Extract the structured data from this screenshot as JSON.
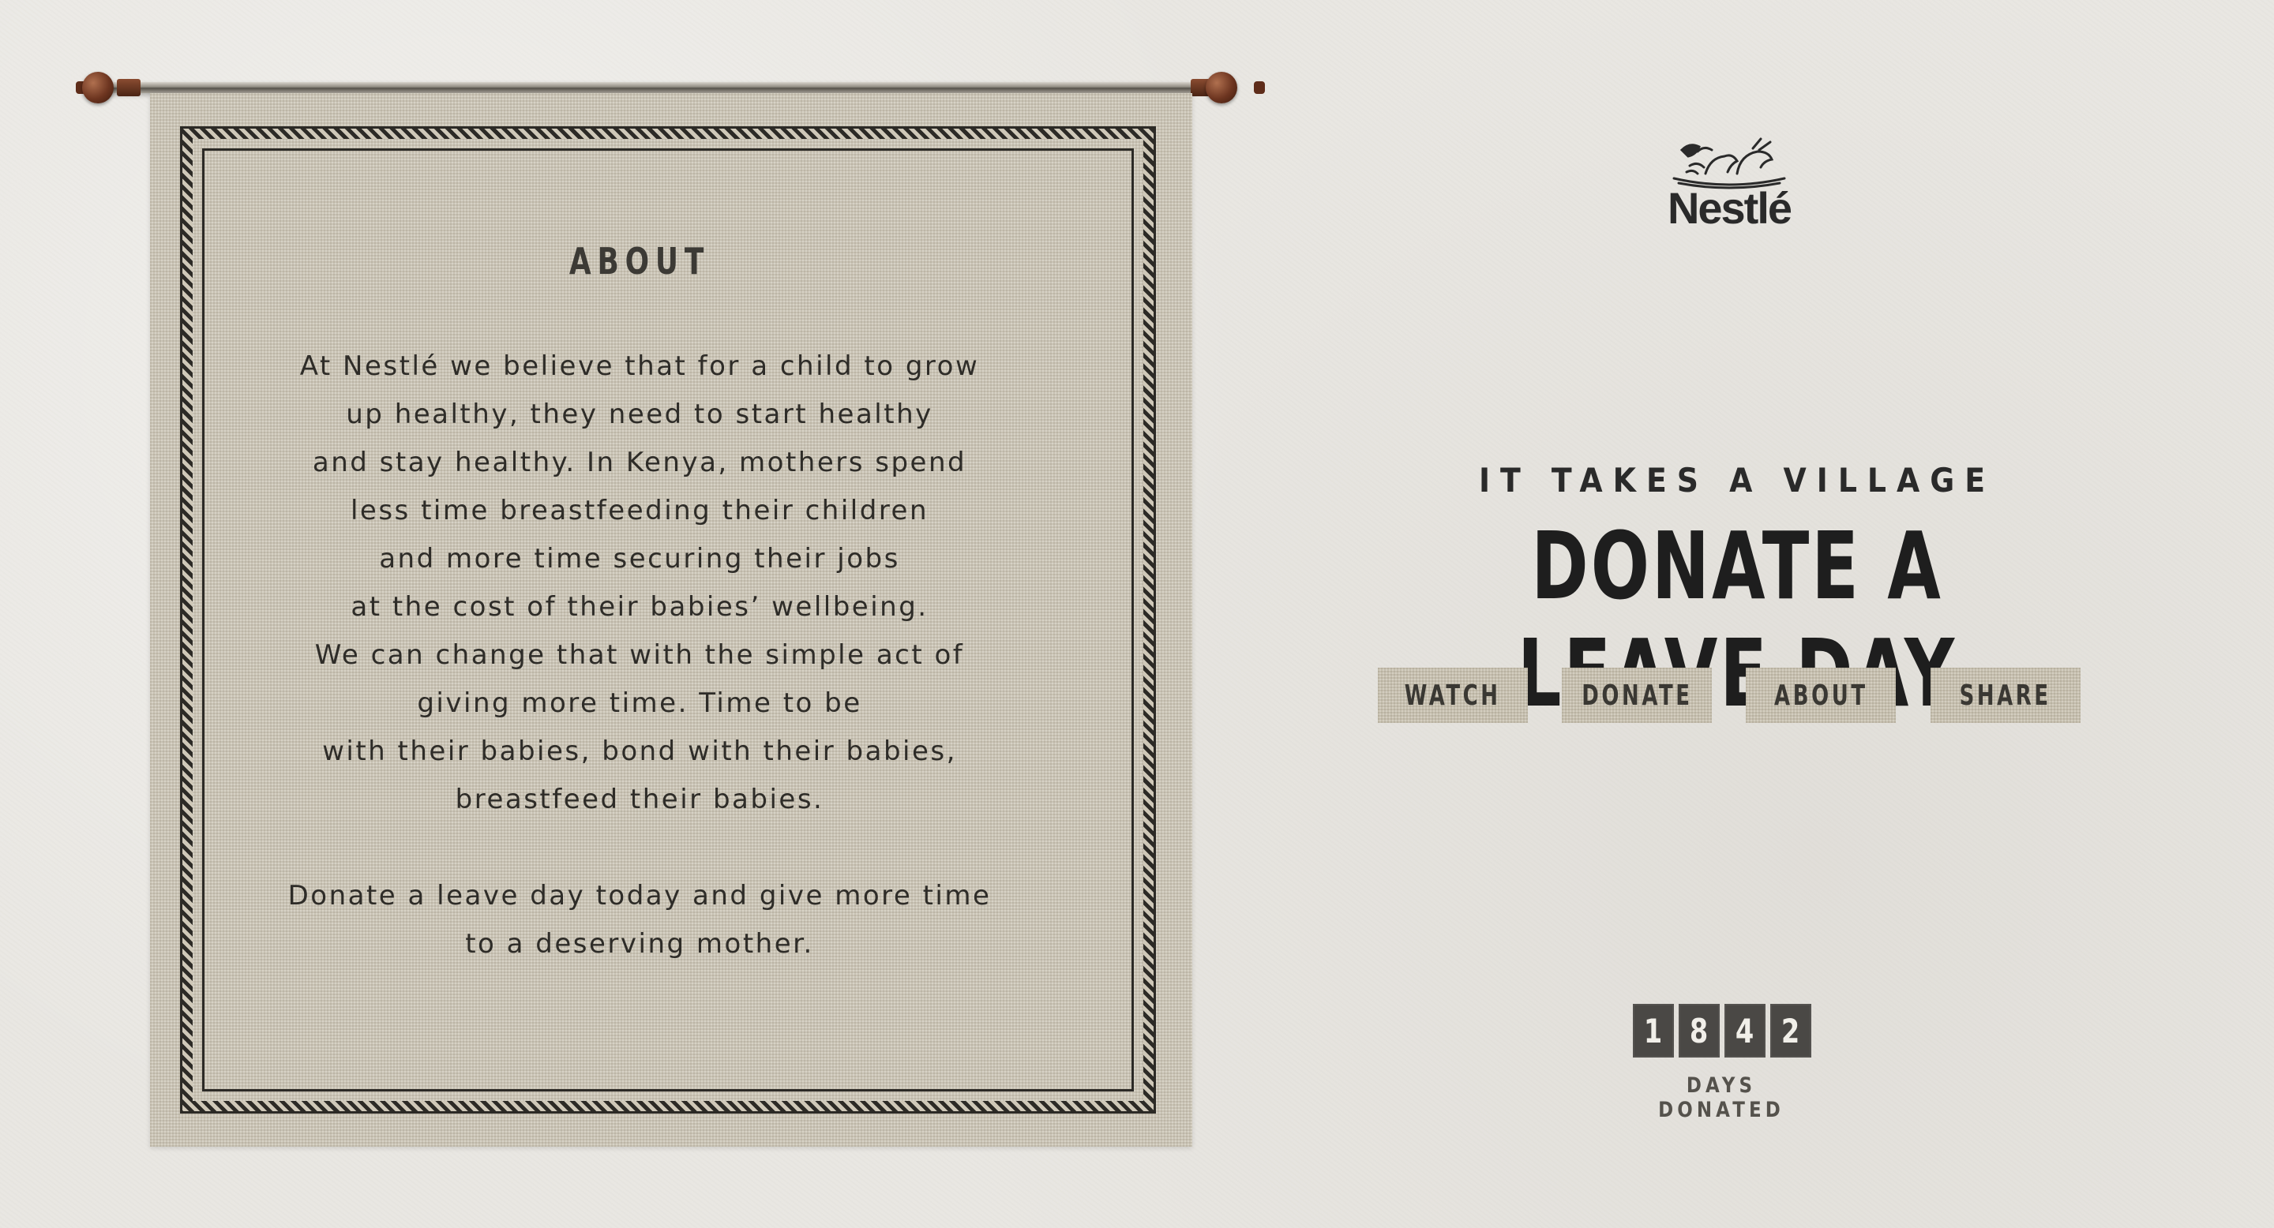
{
  "about": {
    "title": "ABOUT",
    "paragraph_lines": [
      "At Nestlé we believe that for a child to grow",
      "up healthy, they need to start healthy",
      "and stay healthy. In Kenya, mothers spend",
      "less time breastfeeding their children",
      "and more time securing their jobs",
      "at the cost of their babies’ wellbeing.",
      "We can change that with the simple act of",
      "giving more time. Time to be",
      "with their babies, bond with their babies,",
      "breastfeed their babies."
    ],
    "closing_lines": [
      "Donate a leave day today and give more time",
      "to a deserving mother."
    ]
  },
  "brand": {
    "logo_text": "Nestlé",
    "logo_icon": "nest-birds-icon"
  },
  "hero": {
    "tagline": "IT TAKES A VILLAGE",
    "headline": "DONATE A LEAVE DAY"
  },
  "nav": {
    "watch": "WATCH",
    "donate": "DONATE",
    "about": "ABOUT",
    "share": "SHARE"
  },
  "counter": {
    "digits": [
      "1",
      "8",
      "4",
      "2"
    ],
    "label": "DAYS DONATED"
  },
  "colors": {
    "background": "#e9e7e2",
    "fabric": "#d3cdbf",
    "ink": "#2c2a26",
    "counter_tile": "#4a4845"
  }
}
